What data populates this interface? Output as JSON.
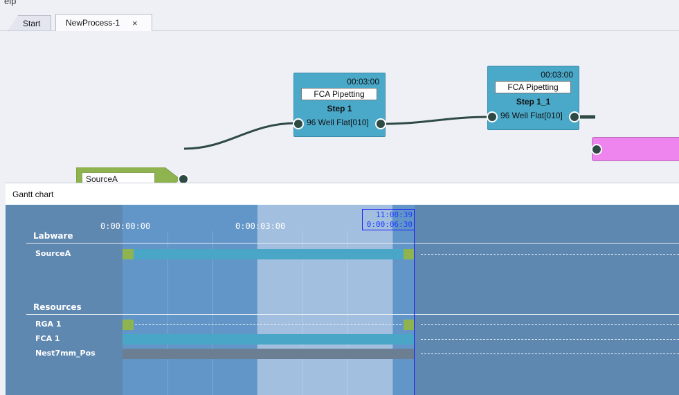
{
  "menu_remnant": "elp",
  "tabs": [
    {
      "label": "Start",
      "close": ""
    },
    {
      "label": "NewProcess-1",
      "close": "×"
    }
  ],
  "process": {
    "source": {
      "name": "SourceA",
      "color": "#8fb44f"
    },
    "steps": [
      {
        "time": "00:03:00",
        "type": "FCA Pipetting",
        "name": "Step 1",
        "labware": "96 Well Flat[010]"
      },
      {
        "time": "00:03:00",
        "type": "FCA Pipetting",
        "name": "Step 1_1",
        "labware": "96 Well Flat[010]"
      }
    ],
    "sink_color": "#ee84ee"
  },
  "gantt": {
    "title": "Gantt chart",
    "time_ticks": [
      "0:00:00:00",
      "0:00:03:00"
    ],
    "cursor": {
      "clock": "11:08:39",
      "elapsed": "0:00:06:30"
    },
    "sections": {
      "labware": "Labware",
      "resources": "Resources"
    },
    "rows": {
      "labware": [
        "SourceA"
      ],
      "resources": [
        "RGA 1",
        "FCA 1",
        "Nest7mm_Pos"
      ]
    },
    "colors": {
      "background": "#5f88b1",
      "active_bar": "#49a6c6",
      "idle_bar": "#6c7e92",
      "marker": "#8fb44f",
      "cursor": "#1a1aff"
    }
  }
}
